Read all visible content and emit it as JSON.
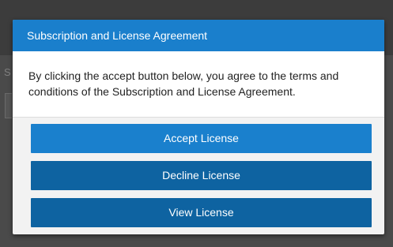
{
  "background": {
    "partial_label": "S"
  },
  "dialog": {
    "title": "Subscription and License Agreement",
    "message": "By clicking the accept button below, you agree to the terms and conditions of the Subscription and License Agreement.",
    "buttons": {
      "accept_label": "Accept License",
      "decline_label": "Decline License",
      "view_label": "View License"
    }
  },
  "colors": {
    "header": "#1a7fcc",
    "accept_button": "#1a80cd",
    "secondary_button": "#0e63a1",
    "overlay": "#3c3c3c"
  }
}
